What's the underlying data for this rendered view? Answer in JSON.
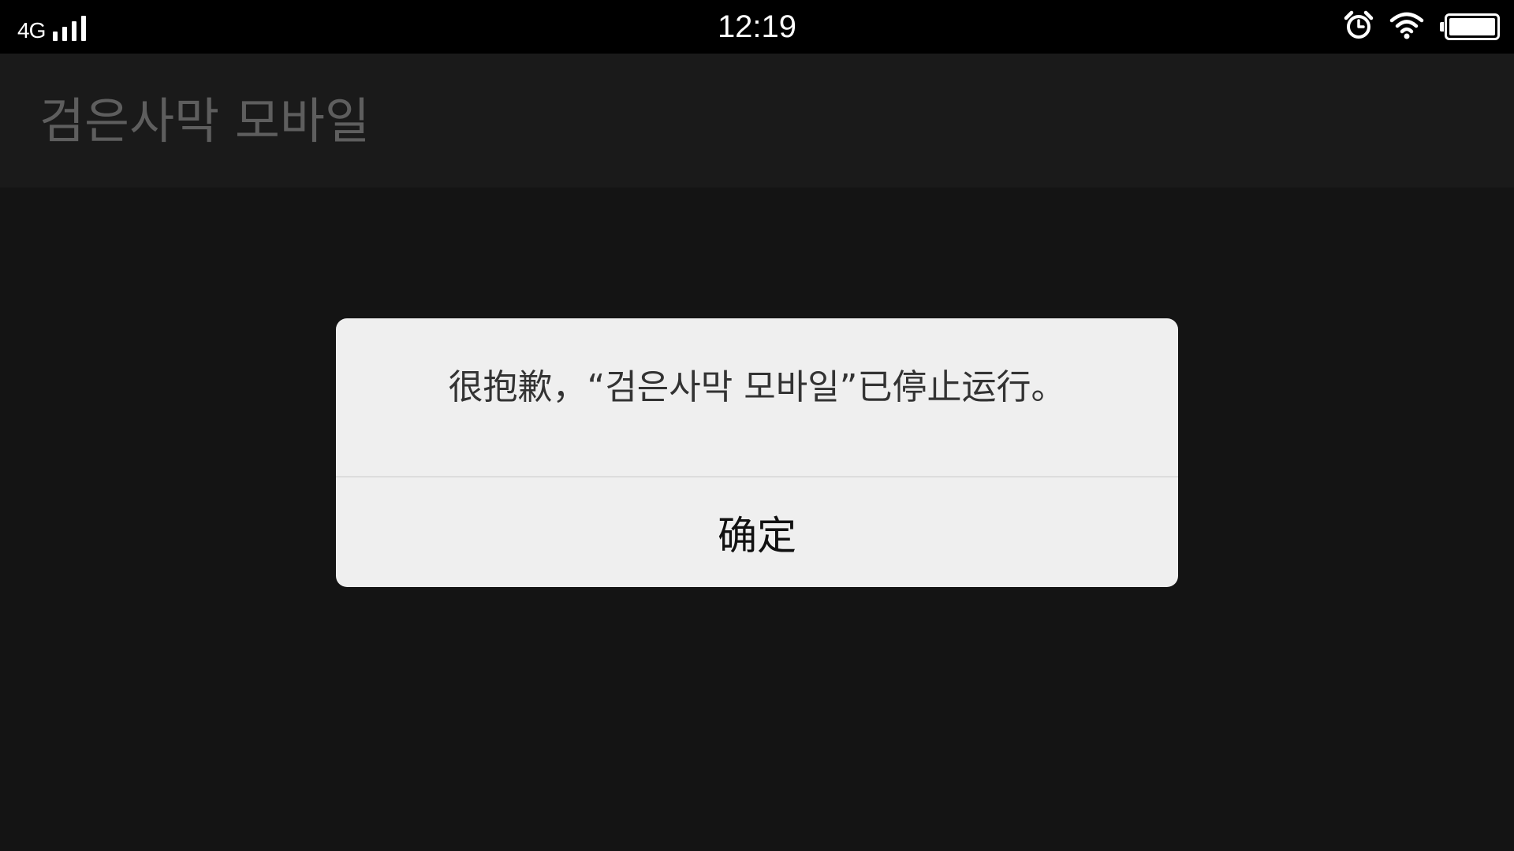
{
  "status_bar": {
    "network_type": "4G",
    "signal_icon": "signal-strength-icon",
    "time": "12:19",
    "alarm_icon": "alarm-clock-icon",
    "wifi_icon": "wifi-icon",
    "battery_icon": "battery-icon",
    "battery_level": 1.0
  },
  "app_bar": {
    "title": "검은사막 모바일"
  },
  "dialog": {
    "message": "很抱歉，“검은사막 모바일”已停止运行。",
    "ok_label": "确定"
  },
  "colors": {
    "background": "#141414",
    "status_bar": "#000000",
    "app_bar": "#1a1a1a",
    "app_title": "#5e5e5e",
    "dialog_bg": "#efefef",
    "dialog_text": "#333333"
  }
}
